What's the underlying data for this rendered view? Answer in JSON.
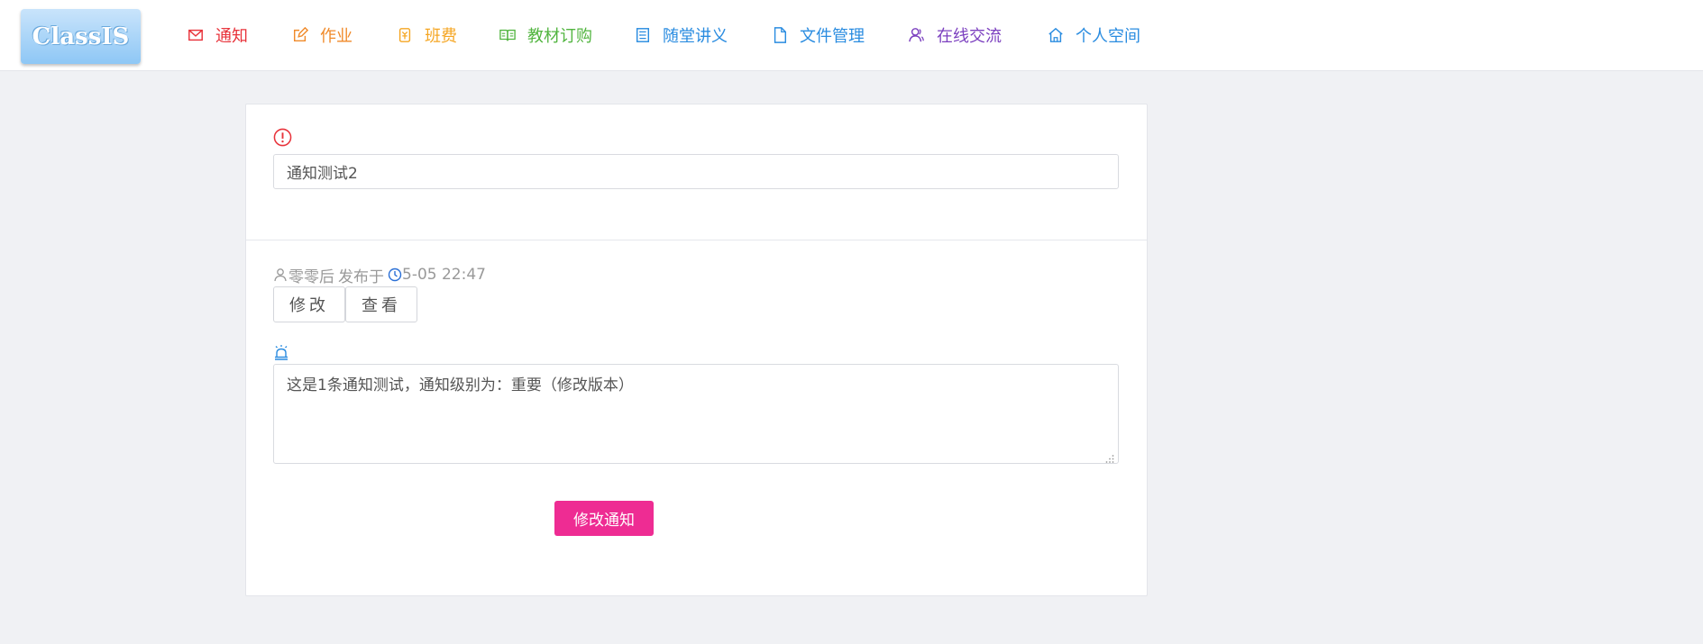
{
  "app": {
    "logo_text": "ClassIS"
  },
  "nav": {
    "items": [
      {
        "label": "通知",
        "icon": "mail-icon",
        "color": "#e8333b"
      },
      {
        "label": "作业",
        "icon": "edit-icon",
        "color": "#f08a2a"
      },
      {
        "label": "班费",
        "icon": "money-icon",
        "color": "#f5a623"
      },
      {
        "label": "教材订购",
        "icon": "book-icon",
        "color": "#52b540"
      },
      {
        "label": "随堂讲义",
        "icon": "list-icon",
        "color": "#2a8ce0"
      },
      {
        "label": "文件管理",
        "icon": "file-icon",
        "color": "#2a8ce0"
      },
      {
        "label": "在线交流",
        "icon": "users-icon",
        "color": "#7b3fbf"
      },
      {
        "label": "个人空间",
        "icon": "home-icon",
        "color": "#2a8ce0"
      }
    ]
  },
  "form": {
    "title_value": "通知测试2",
    "author": "零零后",
    "published_label": "发布于",
    "published_time": "5-05 22:47",
    "edit_button": "修改",
    "view_button": "查看",
    "content_value": "这是1条通知测试，通知级别为：重要（修改版本）",
    "submit_button": "修改通知"
  },
  "colors": {
    "accent": "#ee2c93",
    "warning": "#e8333b",
    "info": "#2a8ce0"
  }
}
